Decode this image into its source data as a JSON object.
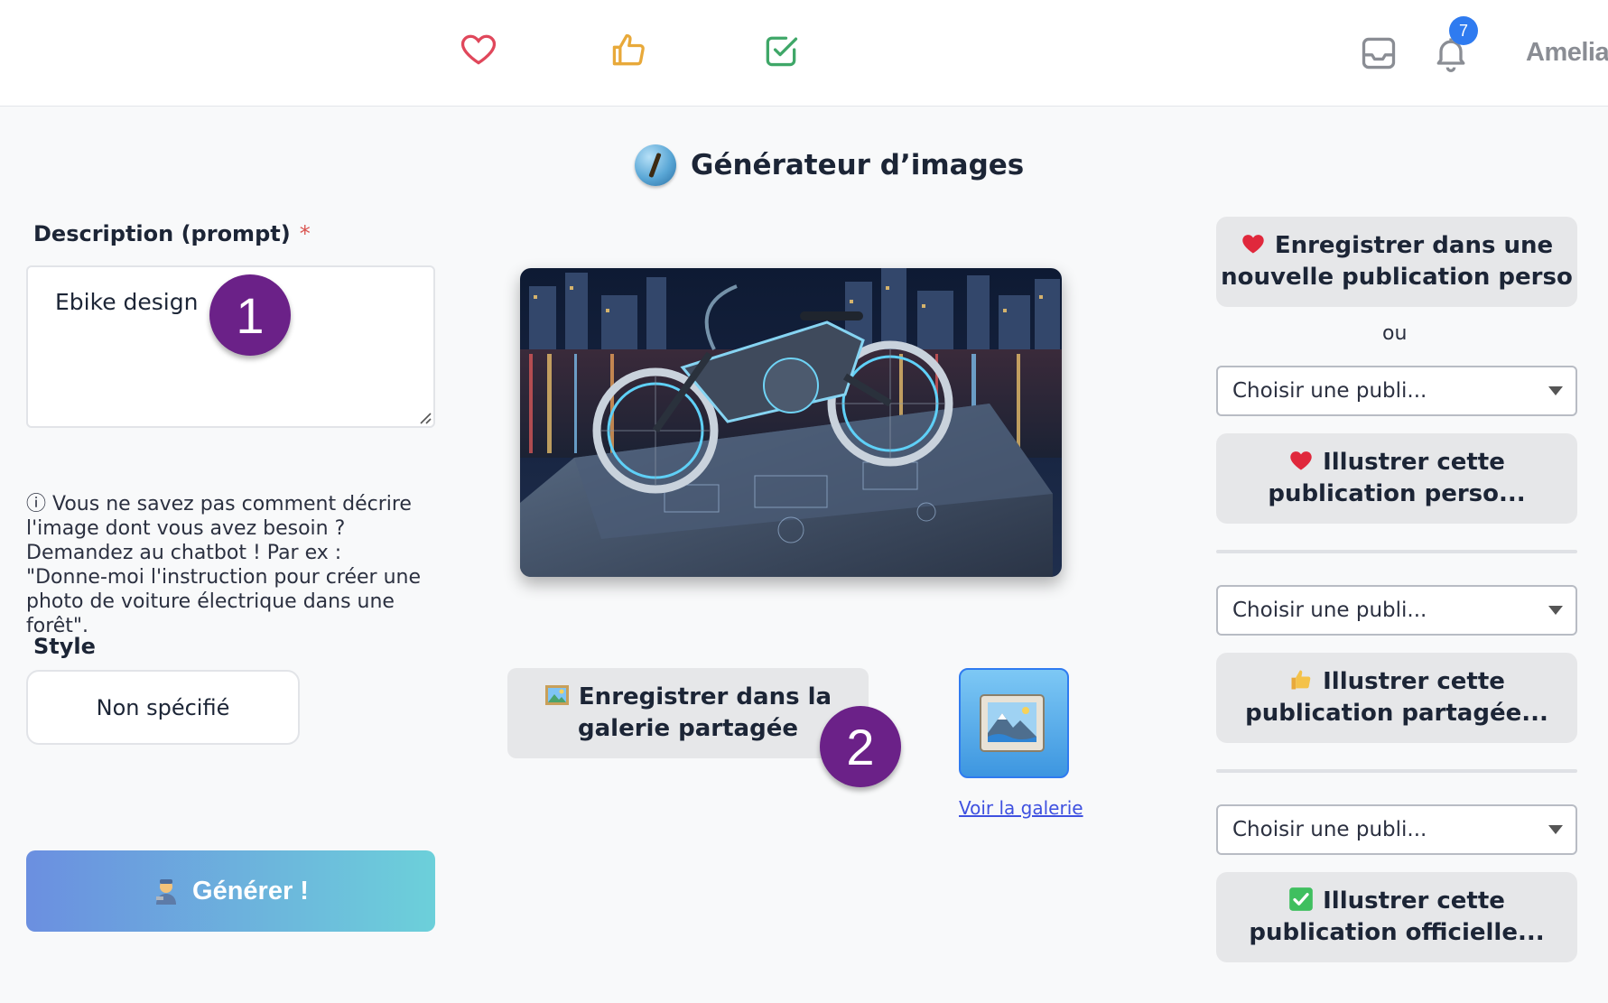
{
  "header": {
    "badge_count": "7",
    "username": "Amelia"
  },
  "page": {
    "title": "Générateur d’images"
  },
  "form": {
    "prompt_label": "Description (prompt)",
    "prompt_required": "*",
    "prompt_value": "Ebike design",
    "help_text": "ⓘ Vous ne savez pas comment décrire l'image dont vous avez besoin ? Demandez au chatbot ! Par ex : \"Donne-moi l'instruction pour créer une photo de voiture électrique dans une forêt\".",
    "style_label": "Style",
    "style_value": "Non spécifié",
    "generate_label": "Générer !"
  },
  "steps": {
    "one": "1",
    "two": "2"
  },
  "center": {
    "save_gallery_line1": "Enregistrer dans la",
    "save_gallery_line2": "galerie partagée",
    "gallery_link": "Voir la galerie"
  },
  "right": {
    "new_publication_line1": "Enregistrer dans une",
    "new_publication_line2": "nouvelle publication perso",
    "or_text": "ou",
    "select_placeholder": "Choisir une publi...",
    "illustrate_perso_line1": "Illustrer cette",
    "illustrate_perso_line2": "publication perso...",
    "illustrate_shared_line1": "Illustrer cette",
    "illustrate_shared_line2": "publication partagée...",
    "illustrate_official_line1": "Illustrer cette",
    "illustrate_official_line2": "publication officielle..."
  },
  "icons": {
    "heart": "heart-icon",
    "thumbs_up": "thumbs-up-icon",
    "check": "check-square-icon",
    "inbox": "inbox-icon",
    "bell": "bell-icon"
  },
  "colors": {
    "heart": "#e0475b",
    "thumb": "#e8a93a",
    "check": "#3fa768",
    "step_badge": "#6b2188",
    "badge": "#2f7bf0"
  }
}
